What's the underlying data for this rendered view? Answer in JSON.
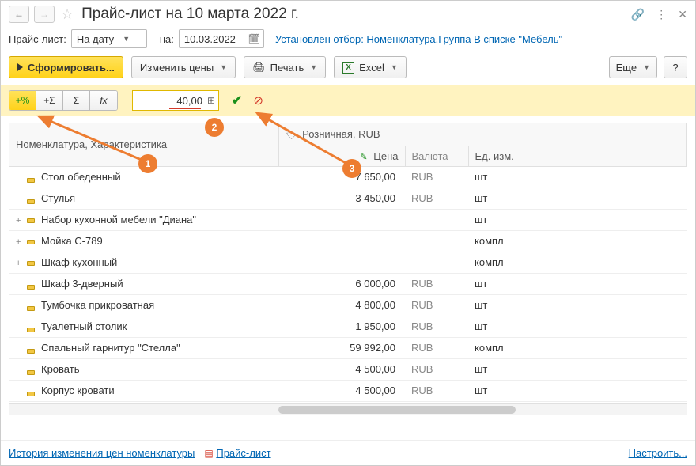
{
  "header": {
    "title": "Прайс-лист на 10 марта 2022 г."
  },
  "filter": {
    "label_pricelist": "Прайс-лист:",
    "pricelist_value": "На дату",
    "label_on": "на:",
    "date_value": "10.03.2022",
    "filter_link": "Установлен отбор: Номенклатура.Группа В списке \"Мебель\""
  },
  "toolbar": {
    "form_label": "Сформировать...",
    "change_prices_label": "Изменить цены",
    "print_label": "Печать",
    "excel_label": "Excel",
    "more_label": "Еще",
    "help_label": "?"
  },
  "actionbar": {
    "pct_label": "+%",
    "sigma_label": "+Σ",
    "all_sigma_label": "Σ",
    "fx_label": "fx",
    "value": "40,00"
  },
  "callouts": {
    "c1": "1",
    "c2": "2",
    "c3": "3"
  },
  "table": {
    "hdr_nomenclature": "Номенклатура, Характеристика",
    "hdr_retail": "Розничная, RUB",
    "hdr_price": "Цена",
    "hdr_currency": "Валюта",
    "hdr_unit": "Ед. изм.",
    "rows": [
      {
        "exp": "",
        "name": "Стол обеденный",
        "price": "7 650,00",
        "curr": "RUB",
        "unit": "шт"
      },
      {
        "exp": "",
        "name": "Стулья",
        "price": "3 450,00",
        "curr": "RUB",
        "unit": "шт"
      },
      {
        "exp": "+",
        "name": "Набор кухонной мебели \"Диана\"",
        "price": "",
        "curr": "",
        "unit": "шт"
      },
      {
        "exp": "+",
        "name": "Мойка С-789",
        "price": "",
        "curr": "",
        "unit": "компл"
      },
      {
        "exp": "+",
        "name": "Шкаф кухонный",
        "price": "",
        "curr": "",
        "unit": "компл"
      },
      {
        "exp": "",
        "name": "Шкаф 3-дверный",
        "price": "6 000,00",
        "curr": "RUB",
        "unit": "шт"
      },
      {
        "exp": "",
        "name": "Тумбочка прикроватная",
        "price": "4 800,00",
        "curr": "RUB",
        "unit": "шт"
      },
      {
        "exp": "",
        "name": "Туалетный столик",
        "price": "1 950,00",
        "curr": "RUB",
        "unit": "шт"
      },
      {
        "exp": "",
        "name": "Спальный гарнитур \"Стелла\"",
        "price": "59 992,00",
        "curr": "RUB",
        "unit": "компл"
      },
      {
        "exp": "",
        "name": "Кровать",
        "price": "4 500,00",
        "curr": "RUB",
        "unit": "шт"
      },
      {
        "exp": "",
        "name": "Корпус кровати",
        "price": "4 500,00",
        "curr": "RUB",
        "unit": "шт"
      }
    ]
  },
  "footer": {
    "history_link": "История изменения цен номенклатуры",
    "pricelist_link": "Прайс-лист",
    "settings_link": "Настроить..."
  }
}
